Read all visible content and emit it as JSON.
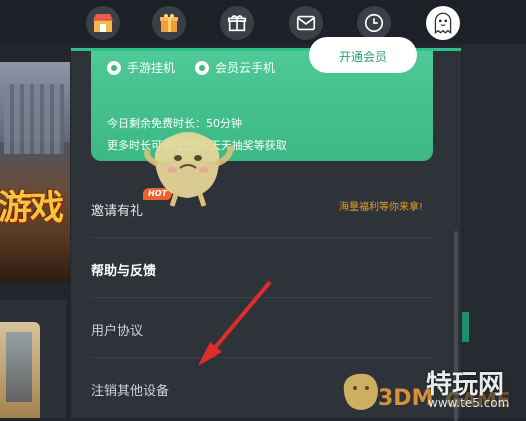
{
  "topbar": {
    "icons": [
      "shop-icon",
      "gift-box-icon",
      "gift-icon",
      "mail-icon",
      "clock-icon",
      "ghost-avatar-icon"
    ]
  },
  "background": {
    "game_title_fragment": "游戏"
  },
  "panel": {
    "promo": {
      "option1": "手游挂机",
      "option2": "会员云手机",
      "open_button": "开通会员",
      "line1": "今日剩余免费时长：50分钟",
      "line2": "更多时长可通过签到/天天抽奖等获取"
    },
    "menu": {
      "invite_label": "邀请有礼",
      "hot_badge": "HOT",
      "invite_tip": "海量福利等你来拿!",
      "help_label": "帮助与反馈",
      "agreement_label": "用户协议",
      "logout_devices_label": "注销其他设备"
    }
  },
  "watermark": {
    "site_name": "特玩网",
    "site_url": "www.te5.com",
    "logo_text": "3DM",
    "logo_suffix": "GAME"
  },
  "colors": {
    "accent_green": "#3bb884",
    "hot_orange": "#f0612e",
    "tip_orange": "#e0a024",
    "annotation_red": "#e02b2b"
  }
}
